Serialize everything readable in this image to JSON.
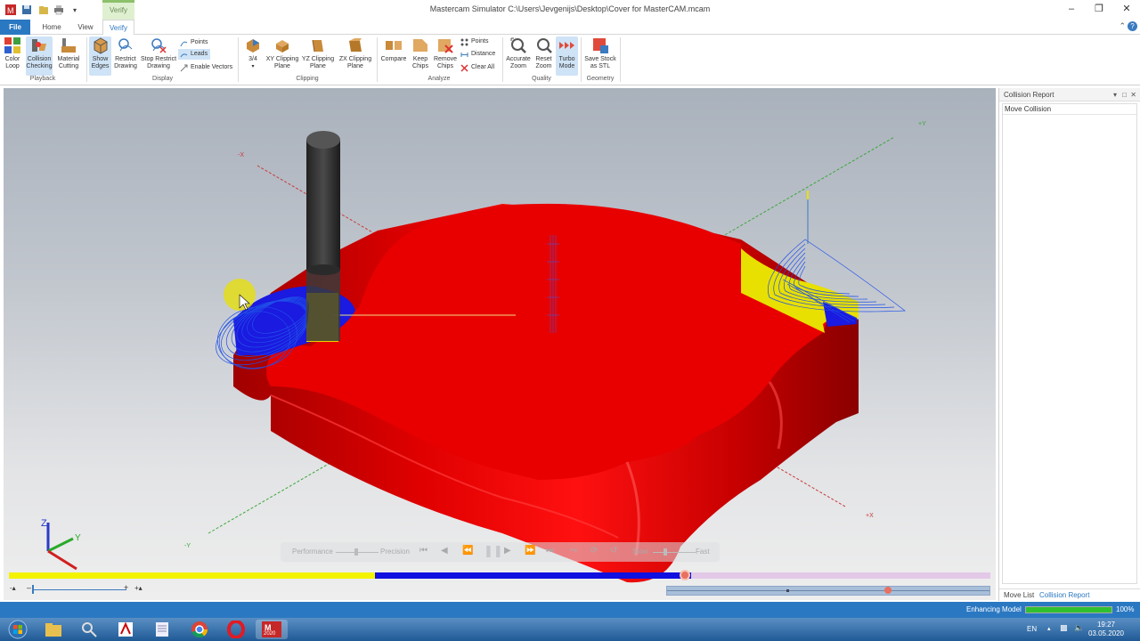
{
  "app": {
    "window_title": "Mastercam Simulator  C:\\Users\\Jevgenijs\\Desktop\\Cover for MasterCAM.mcam",
    "context_tab": "Verify"
  },
  "tabs": [
    {
      "label": "File"
    },
    {
      "label": "Home"
    },
    {
      "label": "View"
    },
    {
      "label": "Verify"
    }
  ],
  "ribbon": {
    "playback": {
      "label": "Playback",
      "color_loop": "Color\nLoop",
      "collision_checking": "Collision\nChecking",
      "material_cutting": "Material\nCutting"
    },
    "display": {
      "label": "Display",
      "show_edges": "Show\nEdges",
      "restrict_drawing": "Restrict\nDrawing",
      "stop_restrict_drawing": "Stop Restrict\nDrawing",
      "points": "Points",
      "leads": "Leads",
      "enable_vectors": "Enable Vectors"
    },
    "clipping": {
      "label": "Clipping",
      "three_quarter": "3/4",
      "xy_plane": "XY Clipping\nPlane",
      "yz_plane": "YZ Clipping\nPlane",
      "zx_plane": "ZX Clipping\nPlane"
    },
    "analyze": {
      "label": "Analyze",
      "compare": "Compare",
      "keep_chips": "Keep\nChips",
      "remove_chips": "Remove\nChips",
      "points": "Points",
      "distance": "Distance",
      "clear_all": "Clear All"
    },
    "quality": {
      "label": "Quality",
      "accurate_zoom": "Accurate\nZoom",
      "reset_zoom": "Reset\nZoom",
      "turbo_mode": "Turbo\nMode"
    },
    "geometry": {
      "label": "Geometry",
      "save_stock": "Save Stock\nas STL"
    }
  },
  "viewport": {
    "axis_labels": {
      "neg_x": "-X",
      "pos_x": "+X",
      "pos_y": "+Y",
      "neg_y": "-Y",
      "z": "Z",
      "y": "Y"
    },
    "playback": {
      "performance": "Performance",
      "precision": "Precision",
      "slow": "Slow",
      "fast": "Fast"
    }
  },
  "timeline": {
    "progress_fraction": 0.69,
    "lower_progress_fraction": 0.68
  },
  "panel": {
    "title": "Collision Report",
    "rows": [
      "Move Collision"
    ],
    "tabs": [
      "Move List",
      "Collision Report"
    ]
  },
  "status": {
    "text": "Enhancing Model",
    "progress_pct": 100,
    "pct_label": "100%"
  },
  "taskbar": {
    "language": "EN",
    "time": "19:27",
    "date": "03.05.2020",
    "mastercam_badge": "2020"
  },
  "colors": {
    "accent": "#2b78c2",
    "stock_red": "#e30000",
    "toolpath_blue": "#1f4fe0",
    "highlight_yellow": "#e8e000"
  }
}
